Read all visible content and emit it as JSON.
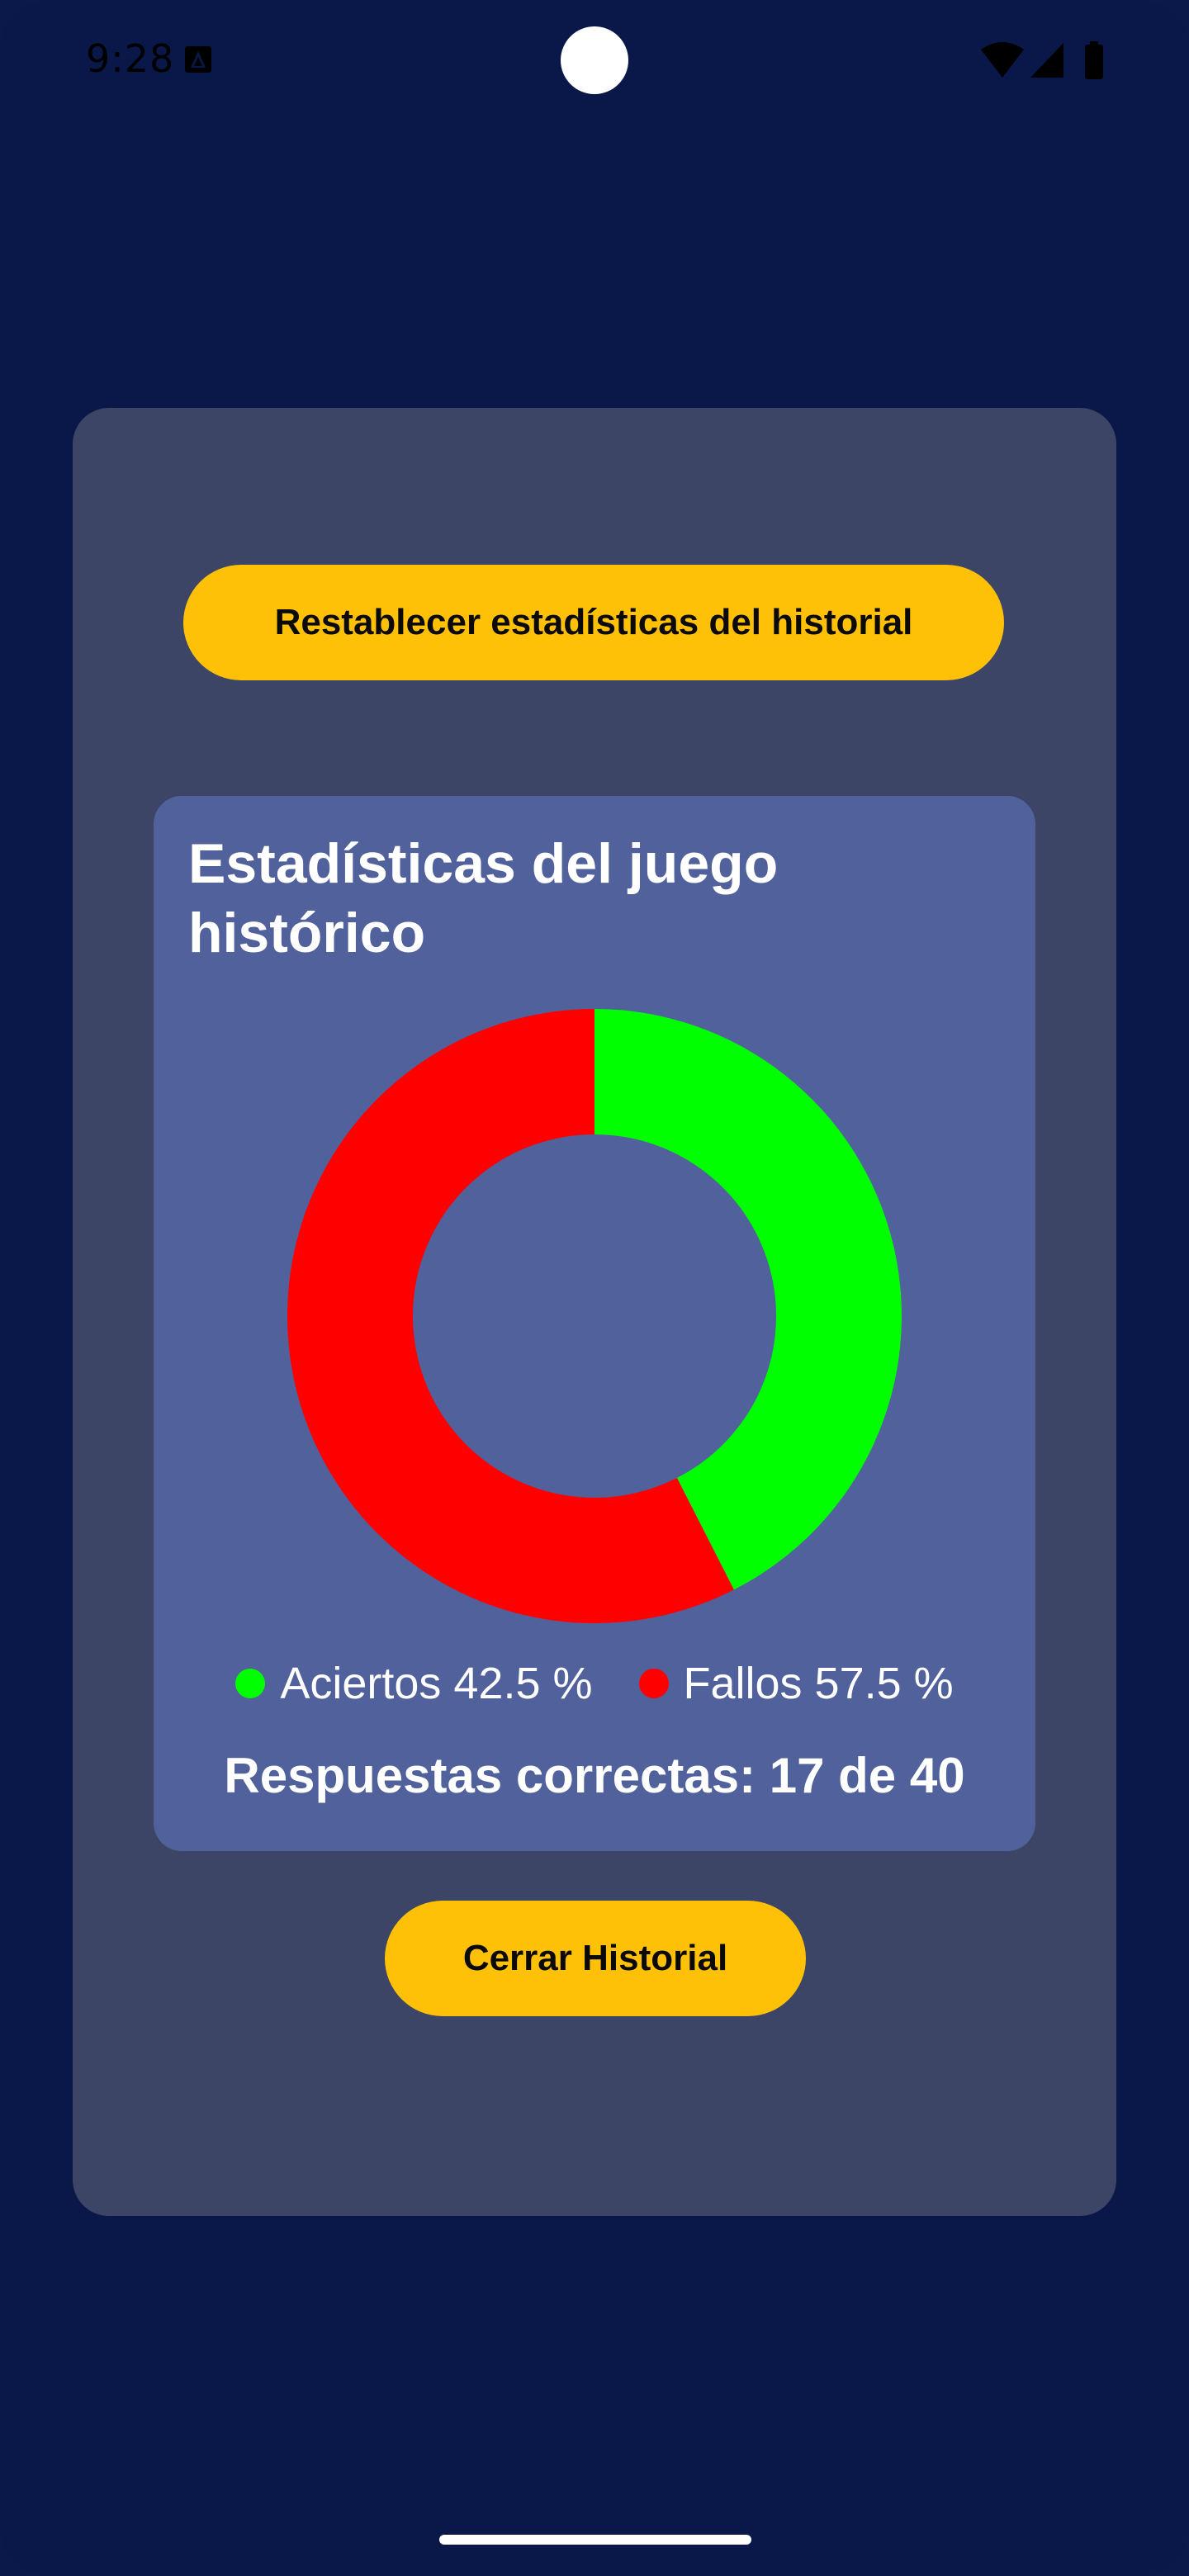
{
  "status_bar": {
    "time": "9:28"
  },
  "dialog": {
    "reset_button_label": "Restablecer estadísticas del historial",
    "card": {
      "title": "Estadísticas del juego histórico",
      "legend": [
        {
          "label": "Aciertos 42.5 %",
          "color": "#00ff00"
        },
        {
          "label": "Fallos 57.5 %",
          "color": "#ff0000"
        }
      ],
      "summary": "Respuestas correctas: 17 de 40"
    },
    "close_button_label": "Cerrar Historial"
  },
  "chart_data": {
    "type": "pie",
    "style": "donut",
    "categories": [
      "Aciertos",
      "Fallos"
    ],
    "values": [
      42.5,
      57.5
    ],
    "colors": [
      "#00ff00",
      "#ff0000"
    ],
    "start_angle": "12 o'clock",
    "direction": "clockwise"
  }
}
